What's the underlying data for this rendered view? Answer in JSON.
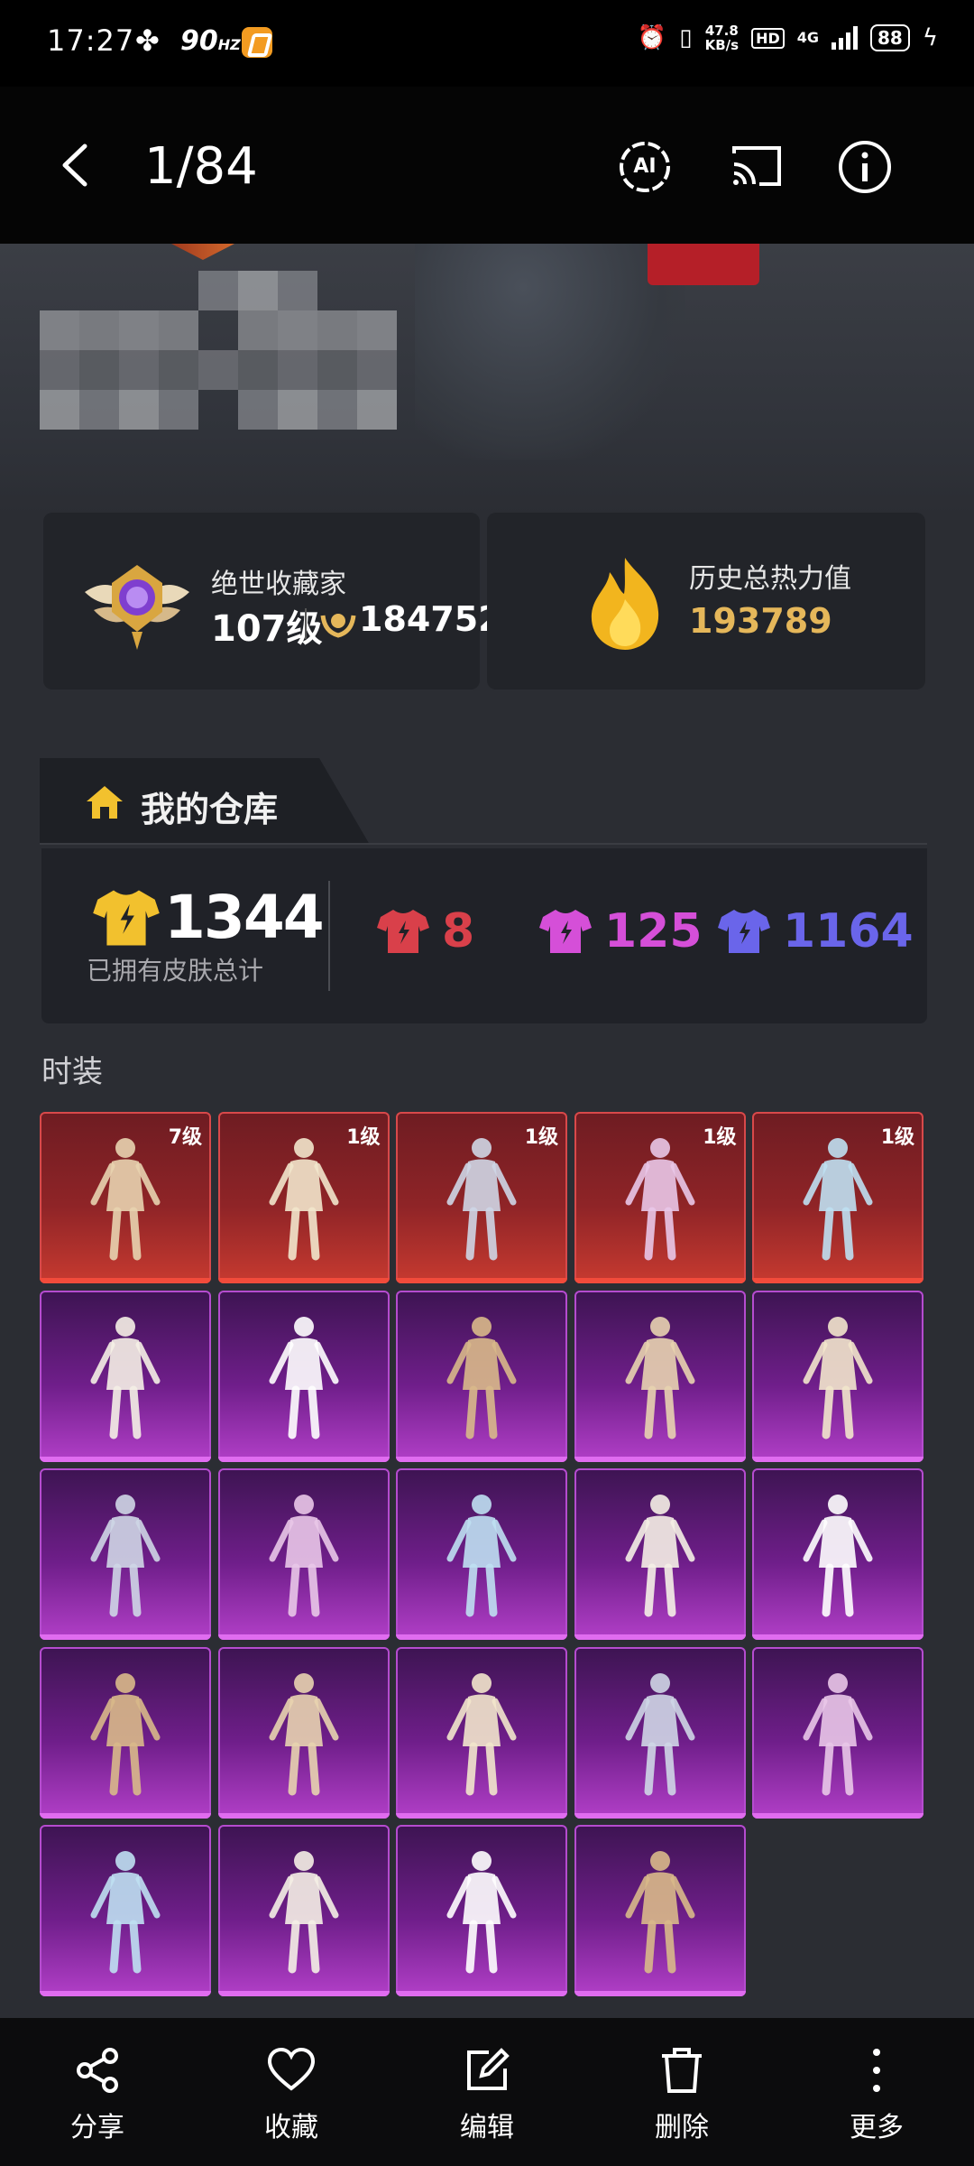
{
  "status_bar": {
    "time": "17:27",
    "refresh_rate": "90",
    "refresh_unit": "HZ",
    "net_speed_value": "47.8",
    "net_speed_unit": "KB/s",
    "hd_label": "HD",
    "network": "4G",
    "battery": "88"
  },
  "app_bar": {
    "page_counter": "1/84",
    "ai_label": "AI"
  },
  "collector": {
    "title": "绝世收藏家",
    "level": "107级",
    "points": "184752"
  },
  "heat": {
    "label": "历史总热力值",
    "value": "193789"
  },
  "warehouse": {
    "title": "我的仓库",
    "total_count": "1344",
    "total_label": "已拥有皮肤总计",
    "red_count": "8",
    "pink_count": "125",
    "blue_count": "1164"
  },
  "section": {
    "title": "时装"
  },
  "skins": [
    {
      "rarity": "red",
      "level": "7级"
    },
    {
      "rarity": "red",
      "level": "1级"
    },
    {
      "rarity": "red",
      "level": "1级"
    },
    {
      "rarity": "red",
      "level": "1级"
    },
    {
      "rarity": "red",
      "level": "1级"
    },
    {
      "rarity": "purple",
      "level": ""
    },
    {
      "rarity": "purple",
      "level": ""
    },
    {
      "rarity": "purple",
      "level": ""
    },
    {
      "rarity": "purple",
      "level": ""
    },
    {
      "rarity": "purple",
      "level": ""
    },
    {
      "rarity": "purple",
      "level": ""
    },
    {
      "rarity": "purple",
      "level": ""
    },
    {
      "rarity": "purple",
      "level": ""
    },
    {
      "rarity": "purple",
      "level": ""
    },
    {
      "rarity": "purple",
      "level": ""
    },
    {
      "rarity": "purple",
      "level": ""
    },
    {
      "rarity": "purple",
      "level": ""
    },
    {
      "rarity": "purple",
      "level": ""
    },
    {
      "rarity": "purple",
      "level": ""
    },
    {
      "rarity": "purple",
      "level": ""
    },
    {
      "rarity": "purple",
      "level": ""
    },
    {
      "rarity": "purple",
      "level": ""
    },
    {
      "rarity": "purple",
      "level": ""
    },
    {
      "rarity": "purple",
      "level": ""
    }
  ],
  "bottom_bar": {
    "share": "分享",
    "favorite": "收藏",
    "edit": "编辑",
    "delete": "删除",
    "more": "更多"
  },
  "colors": {
    "red_rarity": "#d9404a",
    "pink_rarity": "#d54fd8",
    "blue_rarity": "#6a65ea",
    "gold": "#f2c12e",
    "heat_value": "#e5b75a"
  }
}
